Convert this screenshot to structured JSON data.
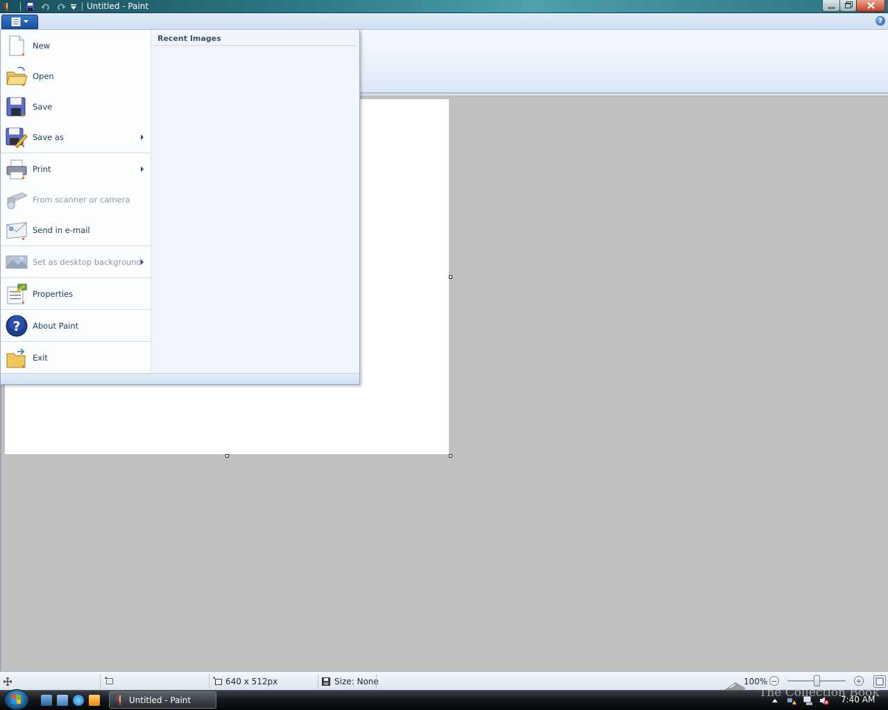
{
  "window": {
    "title": "Untitled - Paint"
  },
  "app_menu": {
    "recent_title": "Recent Images",
    "items": [
      {
        "label": "New",
        "icon": "new-document-icon",
        "enabled": true,
        "submenu": false
      },
      {
        "label": "Open",
        "icon": "open-folder-icon",
        "enabled": true,
        "submenu": false
      },
      {
        "label": "Save",
        "icon": "save-disk-icon",
        "enabled": true,
        "submenu": false
      },
      {
        "label": "Save as",
        "icon": "save-as-icon",
        "enabled": true,
        "submenu": true
      },
      {
        "label": "Print",
        "icon": "printer-icon",
        "enabled": true,
        "submenu": true
      },
      {
        "label": "From scanner or camera",
        "icon": "scanner-icon",
        "enabled": false,
        "submenu": false
      },
      {
        "label": "Send in e-mail",
        "icon": "email-icon",
        "enabled": true,
        "submenu": false
      },
      {
        "label": "Set as desktop background",
        "icon": "desktop-background-icon",
        "enabled": false,
        "submenu": true
      },
      {
        "label": "Properties",
        "icon": "properties-icon",
        "enabled": true,
        "submenu": false
      },
      {
        "label": "About Paint",
        "icon": "help-question-icon",
        "enabled": true,
        "submenu": false
      },
      {
        "label": "Exit",
        "icon": "exit-icon",
        "enabled": true,
        "submenu": false
      }
    ]
  },
  "statusbar": {
    "canvas_size": "640 x 512px",
    "file_size": "Size: None",
    "zoom": "100%",
    "zoom_level_fraction": 0.5
  },
  "taskbar": {
    "task_label": "Untitled - Paint",
    "clock": "7:40 AM",
    "watermark": "The Collection Book"
  },
  "colors": {
    "title_bar": "#2c7a88",
    "menu_background": "#f1f6fd",
    "workspace": "#c0c0c0",
    "menu_text": "#1e395b"
  }
}
